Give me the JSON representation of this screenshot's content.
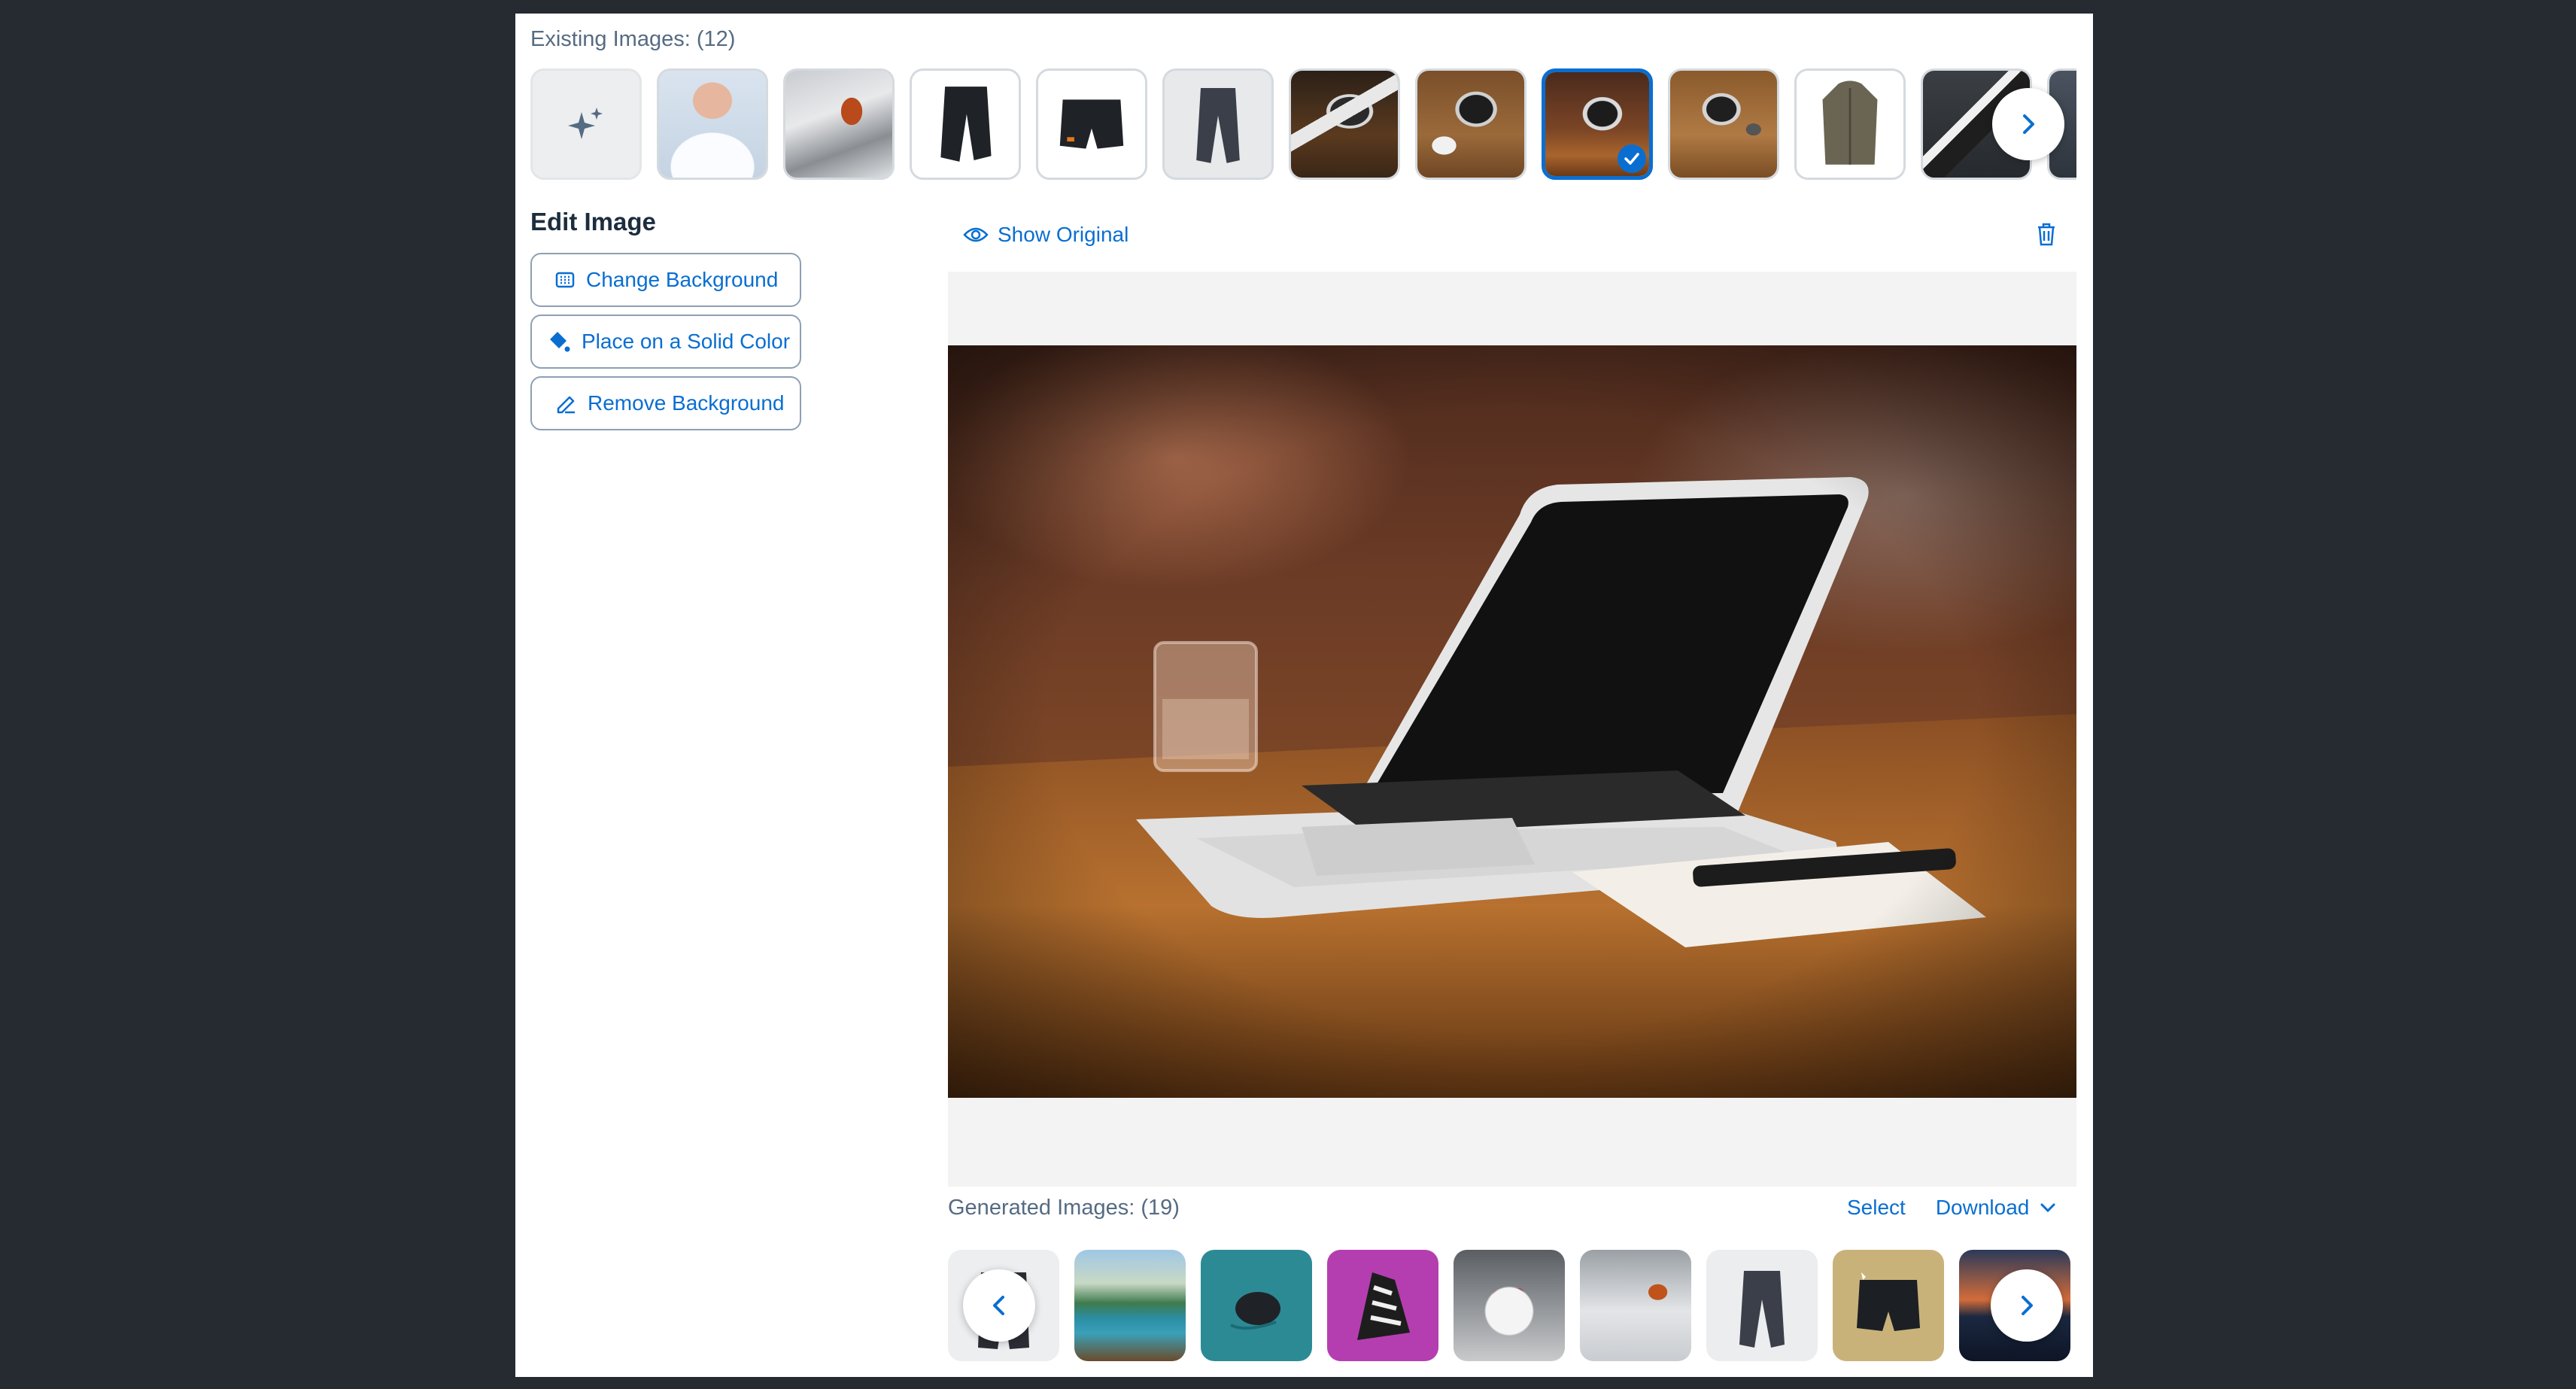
{
  "existing": {
    "label": "Existing Images: (12)",
    "thumbnails": [
      {
        "name": "ai-generate",
        "alt": "generate"
      },
      {
        "name": "nurse",
        "alt": "nurse"
      },
      {
        "name": "snowboarder",
        "alt": "snowboarder"
      },
      {
        "name": "black-capri-pants",
        "alt": "pants"
      },
      {
        "name": "black-shorts",
        "alt": "shorts"
      },
      {
        "name": "gray-joggers",
        "alt": "joggers"
      },
      {
        "name": "laptop-desk-1",
        "alt": "laptop"
      },
      {
        "name": "laptop-desk-2",
        "alt": "laptop"
      },
      {
        "name": "laptop-desk-3",
        "alt": "laptop",
        "selected": true
      },
      {
        "name": "laptop-desk-4",
        "alt": "laptop"
      },
      {
        "name": "jacket",
        "alt": "jacket"
      },
      {
        "name": "sneakers",
        "alt": "sneakers"
      },
      {
        "name": "partial",
        "alt": "more"
      }
    ]
  },
  "edit": {
    "title": "Edit Image",
    "change_background": "Change Background",
    "solid_color": "Place on a Solid Color",
    "remove_background": "Remove Background"
  },
  "preview": {
    "show_original": "Show Original"
  },
  "generated": {
    "label": "Generated Images: (19)",
    "select": "Select",
    "download": "Download"
  },
  "colors": {
    "accent": "#0a6ed1",
    "panel": "#ffffff",
    "backdrop": "#262a31"
  }
}
